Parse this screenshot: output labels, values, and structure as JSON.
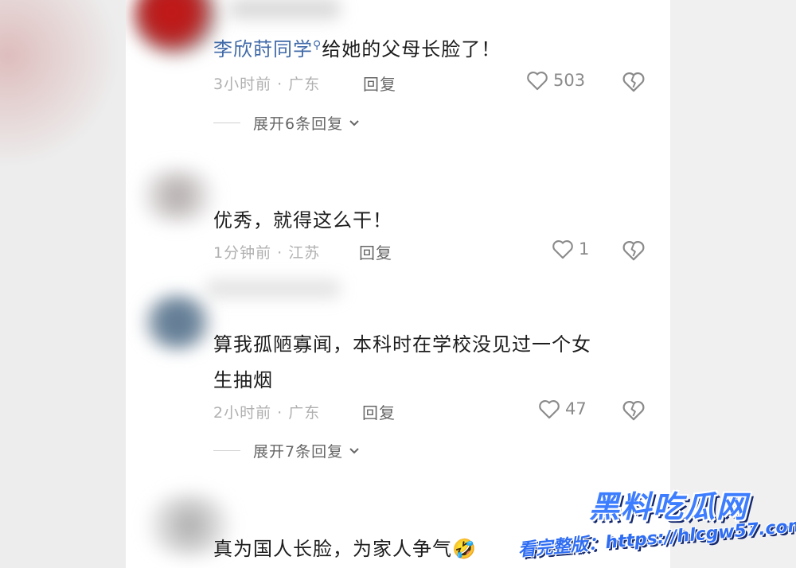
{
  "comments": [
    {
      "mention": "李欣莳同学",
      "text": "给她的父母长脸了！",
      "time_location": "3小时前 · 广东",
      "reply_label": "回复",
      "likes": "503",
      "expand_label": "展开6条回复"
    },
    {
      "text": "优秀，就得这么干！",
      "time_location": "1分钟前 · 江苏",
      "reply_label": "回复",
      "likes": "1"
    },
    {
      "text_line1": "算我孤陋寡闻，本科时在学校没见过一个女",
      "text_line2": "生抽烟",
      "time_location": "2小时前 · 广东",
      "reply_label": "回复",
      "likes": "47",
      "expand_label": "展开7条回复"
    },
    {
      "text": "真为国人长脸，为家人争气",
      "emoji": "🤣"
    }
  ],
  "watermark": {
    "title": "黑料吃瓜网",
    "url_line": "看完整版：https://hlcgw57.com"
  },
  "icons": {
    "like": "heart-outline-icon",
    "dislike": "broken-heart-icon",
    "search": "search-icon",
    "expand": "chevron-down-icon"
  },
  "colors": {
    "mention": "#3f69a8",
    "text": "#1d1d1d",
    "meta": "#b0b0b0",
    "watermark": "#3d7dff"
  }
}
